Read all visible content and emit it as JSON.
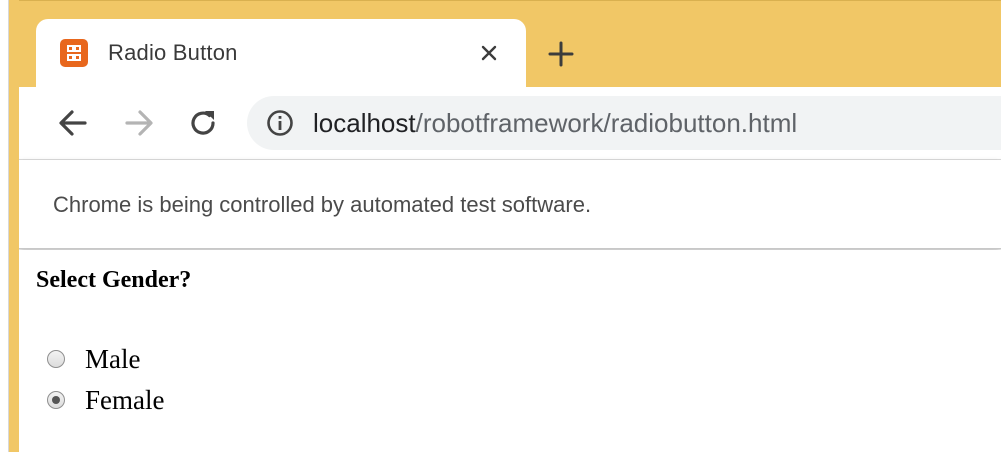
{
  "tab": {
    "title": "Radio Button",
    "favicon": "xampp-icon",
    "close_icon": "close-icon",
    "new_tab_icon": "plus-icon"
  },
  "toolbar": {
    "back_icon": "arrow-left-icon",
    "forward_icon": "arrow-right-icon",
    "reload_icon": "reload-icon",
    "info_icon": "info-icon",
    "url_host": "localhost",
    "url_path": "/robotframework/radiobutton.html"
  },
  "infobar": {
    "message": "Chrome is being controlled by automated test software."
  },
  "page": {
    "heading": "Select Gender?",
    "options": [
      {
        "label": "Male",
        "checked": false
      },
      {
        "label": "Female",
        "checked": true
      }
    ]
  },
  "colors": {
    "titlebar": "#f1c766",
    "favicon": "#e8671d",
    "omnibox": "#f1f3f4"
  }
}
